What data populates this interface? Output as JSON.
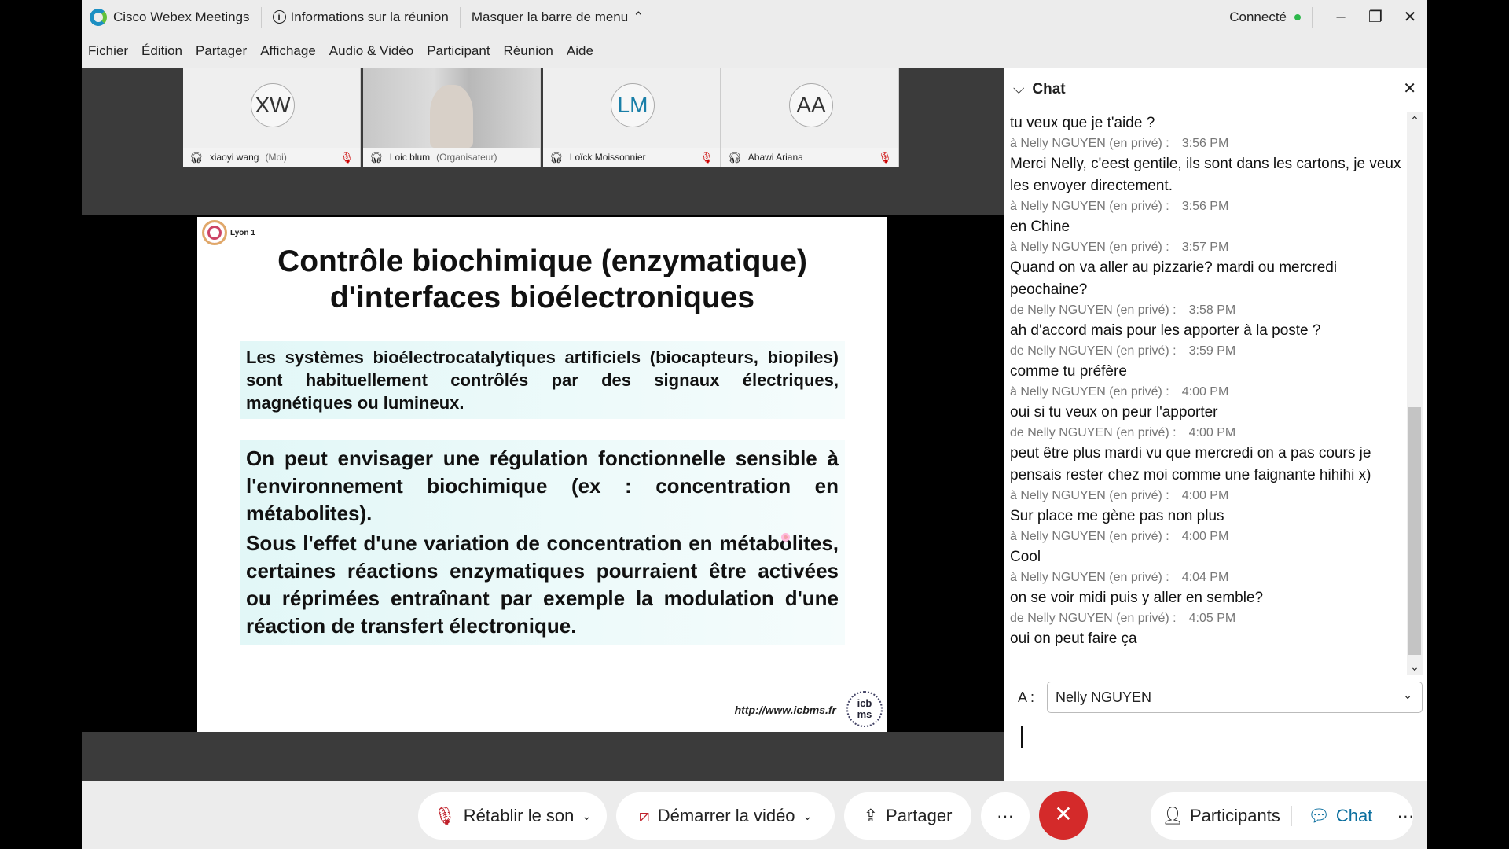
{
  "app": {
    "title": "Cisco Webex Meetings",
    "info": "Informations sur la réunion",
    "hide_menu": "Masquer la barre de menu",
    "status": "Connecté",
    "status_color": "#2db84b"
  },
  "menu": [
    "Fichier",
    "Édition",
    "Partager",
    "Affichage",
    "Audio & Vidéo",
    "Participant",
    "Réunion",
    "Aide"
  ],
  "participants": [
    {
      "initials": "XW",
      "name": "xiaoyi wang",
      "role": "(Moi)",
      "muted": true
    },
    {
      "initials": "",
      "name": "Loic blum",
      "role": "(Organisateur)",
      "muted": false
    },
    {
      "initials": "LM",
      "name": "Loïck Moissonnier",
      "role": "",
      "muted": true
    },
    {
      "initials": "AA",
      "name": "Abawi Ariana",
      "role": "",
      "muted": true
    }
  ],
  "slide": {
    "logo_text": "Lyon 1",
    "title_line1": "Contrôle biochimique (enzymatique)",
    "title_line2": "d'interfaces bioélectroniques",
    "p1": "Les systèmes bioélectrocatalytiques artificiels (biocapteurs, biopiles) sont habituellement contrôlés par des signaux électriques, magnétiques ou lumineux.",
    "p2": "On peut envisager une régulation fonctionnelle sensible à l'environnement biochimique (ex : concentration en métabolites).",
    "p3": "Sous l'effet d'une variation de concentration en métabolites, certaines réactions enzymatiques pourraient être activées ou réprimées entraînant par exemple la modulation d'une réaction de transfert électronique.",
    "url": "http://www.icbms.fr",
    "footer_logo_text": "icb ms"
  },
  "chat": {
    "title": "Chat",
    "messages": [
      {
        "text": "tu veux que je t'aide ?",
        "meta": "à Nelly NGUYEN (en privé) :",
        "time": "3:56 PM"
      },
      {
        "text": "Merci Nelly, c'eest gentile, ils sont dans les cartons, je veux les envoyer directement.",
        "meta": "à Nelly NGUYEN (en privé) :",
        "time": "3:56 PM"
      },
      {
        "text": "en Chine",
        "meta": "à Nelly NGUYEN (en privé) :",
        "time": "3:57 PM"
      },
      {
        "text": "Quand on va aller au pizzarie? mardi ou mercredi peochaine?",
        "meta": "de Nelly NGUYEN (en privé) :",
        "time": "3:58 PM"
      },
      {
        "text": "ah d'accord mais pour les apporter à la poste ?",
        "meta": "de Nelly NGUYEN (en privé) :",
        "time": "3:59 PM"
      },
      {
        "text": "comme tu préfère",
        "meta": "à Nelly NGUYEN (en privé) :",
        "time": "4:00 PM"
      },
      {
        "text": "oui si tu veux on peur l'apporter",
        "meta": "de Nelly NGUYEN (en privé) :",
        "time": "4:00 PM"
      },
      {
        "text": "peut être plus mardi vu que mercredi on a pas cours je pensais rester chez moi comme une faignante hihihi x)",
        "meta": "à Nelly NGUYEN (en privé) :",
        "time": "4:00 PM"
      },
      {
        "text": "Sur place me gène pas non plus",
        "meta": "à Nelly NGUYEN (en privé) :",
        "time": "4:00 PM"
      },
      {
        "text": "Cool",
        "meta": "à Nelly NGUYEN (en privé) :",
        "time": "4:04 PM"
      },
      {
        "text": "on se voir midi puis y aller en semble?",
        "meta": "de Nelly NGUYEN (en privé) :",
        "time": "4:05 PM"
      },
      {
        "text": "oui on peut faire ça",
        "meta": "",
        "time": ""
      }
    ],
    "to_label": "A :",
    "to_value": "Nelly NGUYEN",
    "input_value": ""
  },
  "toolbar": {
    "unmute": "Rétablir le son",
    "video": "Démarrer la vidéo",
    "share": "Partager",
    "more": "···",
    "leave": "✕",
    "participants": "Participants",
    "chat": "Chat",
    "more2": "···",
    "leave_color": "#d42a2a"
  }
}
